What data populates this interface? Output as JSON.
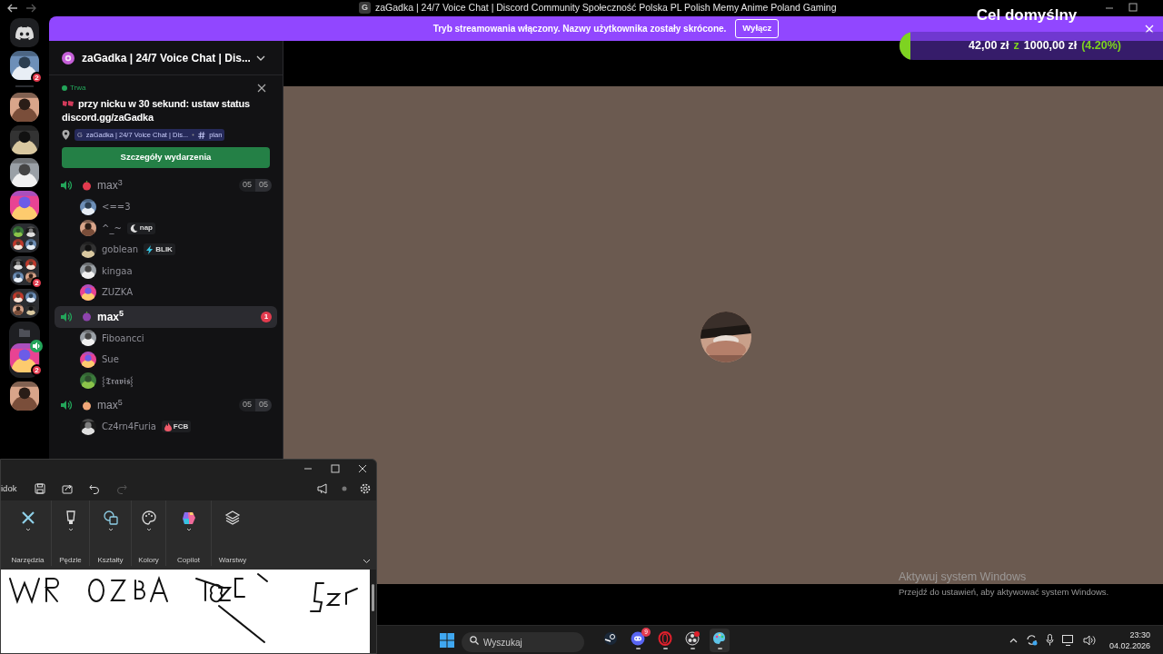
{
  "browser": {
    "title": "zaGadka | 24/7 Voice Chat | Discord Community Społeczność Polska PL Polish Memy Anime Poland Gaming",
    "favicon": "G"
  },
  "servers": [
    {
      "kind": "home"
    },
    {
      "kind": "picture",
      "badge": "2",
      "in_voice": false
    },
    {
      "kind": "picture",
      "in_voice": false
    },
    {
      "kind": "picture",
      "in_voice": false
    },
    {
      "kind": "picture",
      "in_voice": false
    },
    {
      "kind": "picture",
      "in_voice": false
    },
    {
      "kind": "group",
      "in_voice": false
    },
    {
      "kind": "group",
      "badge": "2",
      "in_voice": false
    },
    {
      "kind": "group",
      "in_voice": false
    },
    {
      "kind": "folder",
      "children": [
        {
          "kind": "picture",
          "badge": "2",
          "in_voice": true
        }
      ]
    },
    {
      "kind": "picture",
      "in_voice": false
    }
  ],
  "banner": {
    "text": "Tryb streamowania włączony. Nazwy użytkownika zostały skrócone.",
    "button": "Wyłącz"
  },
  "goal": {
    "title": "Cel domyślny",
    "amount": "42,00 zł",
    "joiner": "z",
    "target": "1000,00 zł",
    "percent": "(4.20%)",
    "level": 0.042
  },
  "server_header": {
    "name": "zaGadka | 24/7 Voice Chat | Dis..."
  },
  "event": {
    "status": "Trwa",
    "title": "przy nicku w 30 sekund: ustaw status discord.gg/zaGadka",
    "server_initial": "G",
    "server": "zaGadka | 24/7 Voice Chat | Dis...",
    "channel": "plan",
    "button": "Szczegóły wydarzenia"
  },
  "channels": [
    {
      "name": "max$^{3}$",
      "color": "#e23b4e",
      "selected": false,
      "counts": [
        "05",
        "05"
      ],
      "users": [
        {
          "name": "<==3"
        },
        {
          "name": "^_~",
          "tag": {
            "text": "nap",
            "kind": "moon"
          }
        },
        {
          "name": "goblean",
          "tag": {
            "text": "BLIK",
            "kind": "bolt"
          }
        },
        {
          "name": "kingaa"
        },
        {
          "name": "ZUZKA"
        }
      ]
    },
    {
      "name": "max$^{5}$",
      "color": "#8e44ad",
      "selected": true,
      "badge": "1",
      "users": [
        {
          "name": "Fiboancci"
        },
        {
          "name": "Sue"
        },
        {
          "name": "⸾𝕿𝖗𝖆𝖛𝖎𝖘⸾"
        }
      ]
    },
    {
      "name": "max$^{5}$",
      "color": "#f0a878",
      "selected": false,
      "counts": [
        "05",
        "05"
      ],
      "users": [
        {
          "name": "Cz4rn4Furia",
          "tag": {
            "text": "FCB",
            "kind": "fire"
          }
        }
      ]
    }
  ],
  "watermark": {
    "title": "Aktywuj system Windows",
    "text": "Przejdź do ustawień, aby aktywować system Windows."
  },
  "paint": {
    "menu": "idok",
    "tools": [
      "Narzędzia",
      "Pędzle",
      "Kształty",
      "Kolory",
      "Copilot",
      "Warstwy"
    ]
  },
  "taskbar": {
    "search": {
      "placeholder": "Wyszukaj"
    },
    "apps": [
      {
        "kind": "steam",
        "running": false
      },
      {
        "kind": "discord",
        "badge": "9",
        "running": true
      },
      {
        "kind": "opera",
        "running": true
      },
      {
        "kind": "obs",
        "running": true
      },
      {
        "kind": "paint",
        "running": true
      }
    ],
    "time": "23:30",
    "date": "04.02.2026"
  }
}
